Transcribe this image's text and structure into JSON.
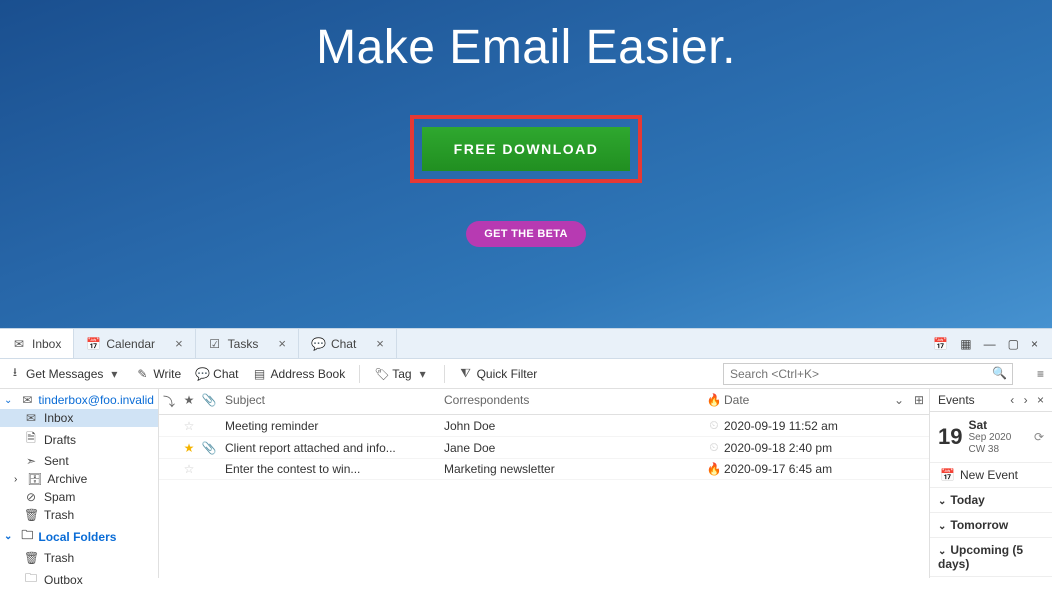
{
  "hero": {
    "title": "Make Email Easier.",
    "download_label": "FREE DOWNLOAD",
    "beta_label": "GET THE BETA"
  },
  "tabs": [
    {
      "label": "Inbox",
      "icon": "mail-icon",
      "closable": false
    },
    {
      "label": "Calendar",
      "icon": "calendar-icon",
      "closable": true
    },
    {
      "label": "Tasks",
      "icon": "tasks-icon",
      "closable": true
    },
    {
      "label": "Chat",
      "icon": "chat-icon",
      "closable": true
    }
  ],
  "toolbar": {
    "get_messages": "Get Messages",
    "write": "Write",
    "chat": "Chat",
    "address_book": "Address Book",
    "tag": "Tag",
    "quick_filter": "Quick Filter",
    "search_placeholder": "Search <Ctrl+K>"
  },
  "sidebar": {
    "account": "tinderbox@foo.invalid",
    "items": [
      {
        "label": "Inbox",
        "icon": "mail-icon",
        "selected": true
      },
      {
        "label": "Drafts",
        "icon": "draft-icon"
      },
      {
        "label": "Sent",
        "icon": "sent-icon"
      },
      {
        "label": "Archive",
        "icon": "archive-icon",
        "expandable": true
      },
      {
        "label": "Spam",
        "icon": "spam-icon"
      },
      {
        "label": "Trash",
        "icon": "trash-icon"
      }
    ],
    "local_label": "Local Folders",
    "local_items": [
      {
        "label": "Trash",
        "icon": "trash-icon"
      },
      {
        "label": "Outbox",
        "icon": "outbox-icon"
      }
    ]
  },
  "columns": {
    "subject": "Subject",
    "correspondents": "Correspondents",
    "date": "Date"
  },
  "messages": [
    {
      "star": false,
      "attach": false,
      "subject": "Meeting reminder",
      "from": "John Doe",
      "fire": false,
      "date": "2020-09-19 11:52 am"
    },
    {
      "star": true,
      "attach": true,
      "subject": "Client report attached and info...",
      "from": "Jane Doe",
      "fire": false,
      "date": "2020-09-18 2:40 pm"
    },
    {
      "star": false,
      "attach": false,
      "subject": "Enter the contest to win...",
      "from": "Marketing newsletter",
      "fire": true,
      "date": "2020-09-17 6:45 am"
    }
  ],
  "events": {
    "title": "Events",
    "day_num": "19",
    "day_name": "Sat",
    "day_sub": "Sep 2020 CW 38",
    "new_event": "New Event",
    "sections": [
      "Today",
      "Tomorrow",
      "Upcoming (5 days)"
    ]
  }
}
